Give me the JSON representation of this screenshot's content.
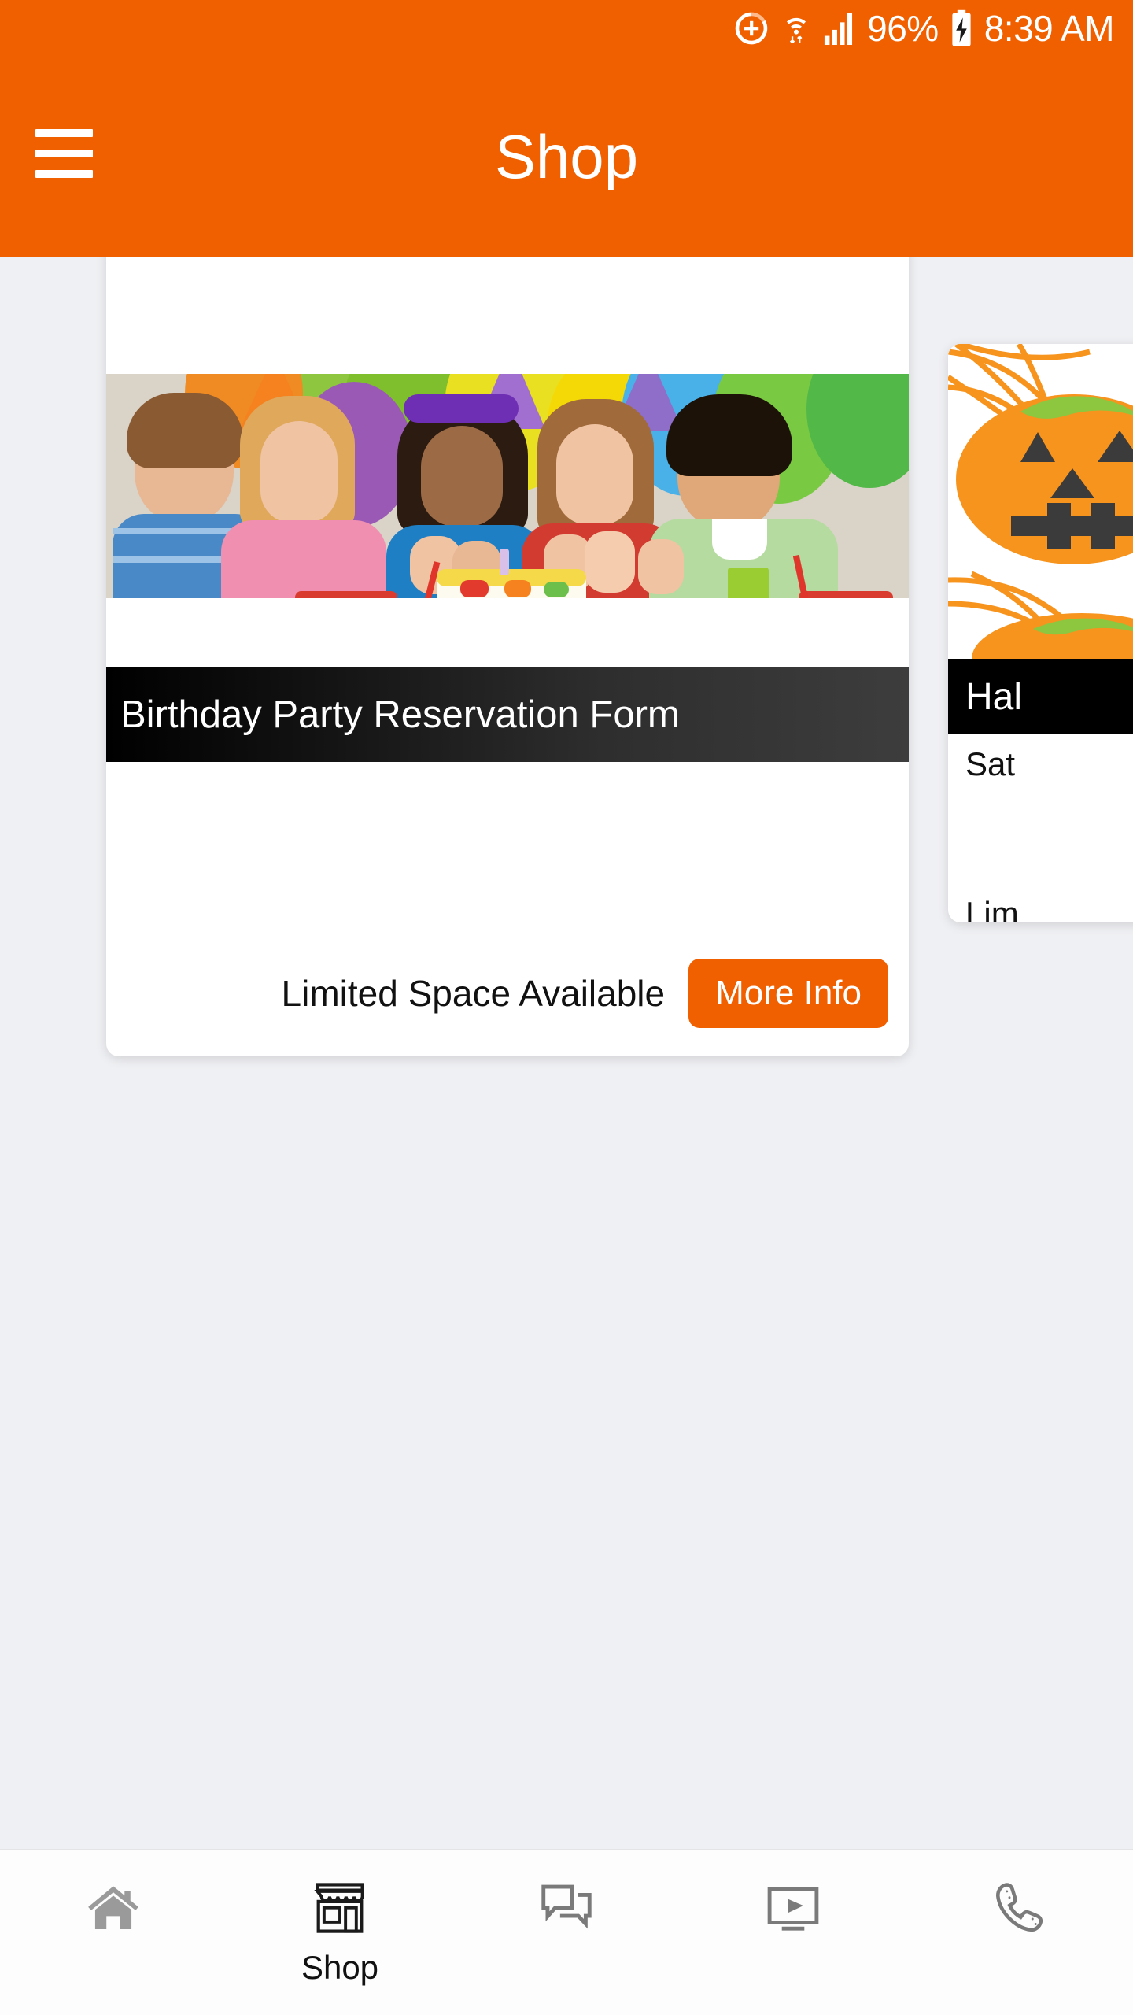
{
  "status_bar": {
    "battery_percent": "96%",
    "time": "8:39 AM",
    "icons": [
      "add-circle-icon",
      "wifi-icon",
      "signal-bars-icon",
      "battery-charging-icon"
    ]
  },
  "app_bar": {
    "title": "Shop",
    "menu_icon": "hamburger-menu-icon"
  },
  "cards": [
    {
      "title": "Birthday Party Reservation Form",
      "image_alt": "children-birthday-party-photo",
      "footer_note": "Limited Space Available",
      "button_label": "More Info"
    },
    {
      "title": "Hal",
      "image_alt": "halloween-pumpkin-spiderweb-photo",
      "subtitle": "Sat",
      "footer_note": "Lim"
    }
  ],
  "bottom_nav": {
    "items": [
      {
        "icon": "home-icon",
        "label": "",
        "active": false
      },
      {
        "icon": "store-icon",
        "label": "Shop",
        "active": true
      },
      {
        "icon": "chat-icon",
        "label": "",
        "active": false
      },
      {
        "icon": "video-icon",
        "label": "",
        "active": false
      },
      {
        "icon": "phone-icon",
        "label": "",
        "active": false
      }
    ]
  },
  "colors": {
    "brand_orange": "#F06000",
    "page_background": "#eff0f3",
    "card_background": "#ffffff",
    "title_bar_dark": "#000000",
    "nav_inactive": "#9a9a9a",
    "nav_active": "#1a1a1a"
  }
}
